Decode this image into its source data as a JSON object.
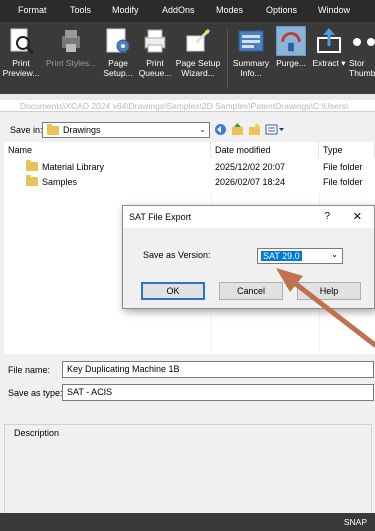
{
  "menu": [
    "Format",
    "Tools",
    "Modify",
    "AddOns",
    "Modes",
    "Options",
    "Window"
  ],
  "ribbon": {
    "buttons": [
      {
        "label1": "Print",
        "label2": "Preview...",
        "icon": "print-preview-icon"
      },
      {
        "label1": "Print Styles...",
        "label2": "",
        "icon": "print-styles-icon"
      },
      {
        "label1": "Page",
        "label2": "Setup...",
        "icon": "page-setup-icon"
      },
      {
        "label1": "Print",
        "label2": "Queue...",
        "icon": "print-queue-icon"
      },
      {
        "label1": "Page Setup",
        "label2": "Wizard...",
        "icon": "page-setup-wizard-icon"
      },
      {
        "label1": "Summary",
        "label2": "Info...",
        "icon": "summary-info-icon"
      },
      {
        "label1": "Purge...",
        "label2": "",
        "icon": "purge-icon"
      },
      {
        "label1": "Extract",
        "label2": "",
        "icon": "extract-icon"
      },
      {
        "label1": "Stor",
        "label2": "Thumbn",
        "icon": "more-icon"
      }
    ]
  },
  "path_text": "Documents\\XCAD 2024 x64\\Drawings\\Samples\\2D Samples\\PatentDrawings\\C:\\Users\\",
  "dialog": {
    "save_in_label": "Save in:",
    "save_in_value": "Drawings",
    "columns": [
      "Name",
      "Date modified",
      "Type"
    ],
    "rows": [
      {
        "name": "Material Library",
        "date": "2025/12/02 20:07",
        "type": "File folder"
      },
      {
        "name": "Samples",
        "date": "2026/02/07 18:24",
        "type": "File folder"
      }
    ],
    "file_name_label": "File name:",
    "file_name_value": "Key Duplicating Machine 1B",
    "save_as_type_label": "Save as type:",
    "save_as_type_value": "SAT - ACIS",
    "description_label": "Description"
  },
  "modal": {
    "title": "SAT File Export",
    "help_glyph": "?",
    "close_glyph": "✕",
    "version_label": "Save as Version:",
    "version_value": "SAT 29.0",
    "ok": "OK",
    "cancel": "Cancel",
    "help": "Help"
  },
  "status": {
    "snap": "SNAP"
  },
  "colors": {
    "accent": "#0078d7",
    "arrow": "#c0714f"
  }
}
